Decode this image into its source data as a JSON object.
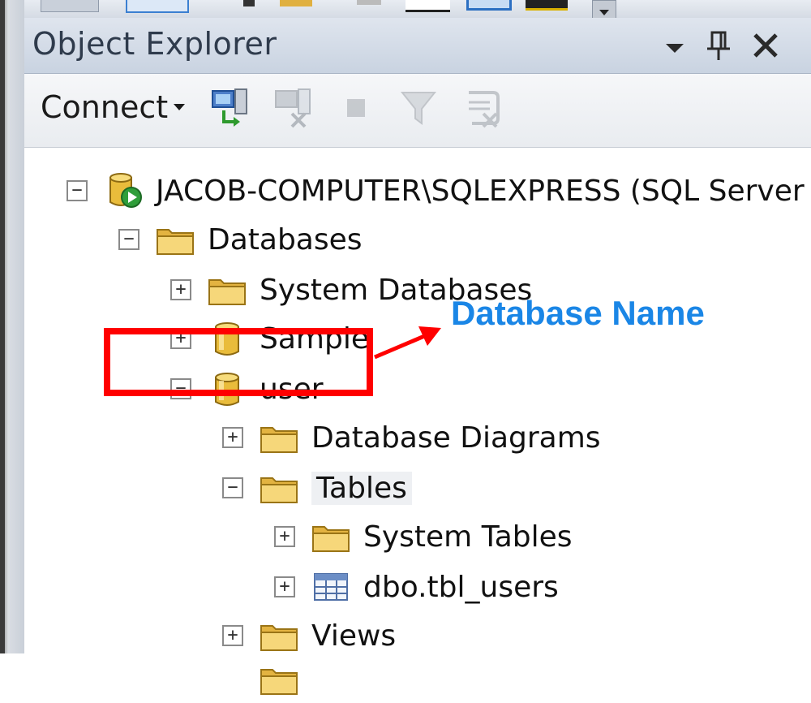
{
  "panel": {
    "title": "Object Explorer",
    "toolbar": {
      "connect_label": "Connect"
    },
    "title_buttons": [
      "chevron-down-icon",
      "pin-icon",
      "close-icon"
    ],
    "toolbar_icons": [
      "connect-object-explorer-icon",
      "disconnect-icon",
      "stop-icon",
      "filter-icon",
      "refresh-icon"
    ]
  },
  "tree": [
    {
      "label": "JACOB-COMPUTER\\SQLEXPRESS (SQL Server",
      "expander": "−",
      "icon": "server-icon"
    },
    {
      "label": "Databases",
      "expander": "−",
      "icon": "folder-icon"
    },
    {
      "label": "System Databases",
      "expander": "+",
      "icon": "folder-icon"
    },
    {
      "label": "Sample",
      "expander": "+",
      "icon": "database-icon"
    },
    {
      "label": "user",
      "expander": "−",
      "icon": "database-icon"
    },
    {
      "label": "Database Diagrams",
      "expander": "+",
      "icon": "folder-icon"
    },
    {
      "label": "Tables",
      "expander": "−",
      "icon": "folder-icon",
      "selected": true
    },
    {
      "label": "System Tables",
      "expander": "+",
      "icon": "folder-icon"
    },
    {
      "label": "dbo.tbl_users",
      "expander": "+",
      "icon": "table-icon"
    },
    {
      "label": "Views",
      "expander": "+",
      "icon": "folder-icon"
    }
  ],
  "annotation": {
    "text": "Database Name",
    "color": "#1a86e6",
    "box_color": "#ff0000"
  }
}
